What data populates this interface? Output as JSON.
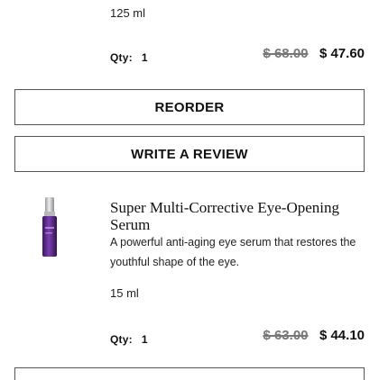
{
  "order_item_1": {
    "size": "125 ml",
    "qty_label": "Qty:",
    "qty_value": "1",
    "original_price": "$ 68.00",
    "sale_price": "$ 47.60"
  },
  "actions": {
    "reorder_label": "REORDER",
    "review_label": "WRITE A REVIEW"
  },
  "order_item_2": {
    "title": "Super Multi-Corrective Eye-Opening Serum",
    "description": "A powerful anti-aging eye serum that restores the youthful shape of the eye.",
    "size": "15 ml",
    "qty_label": "Qty:",
    "qty_value": "1",
    "original_price": "$ 63.00",
    "sale_price": "$ 44.10"
  },
  "colors": {
    "bottle_purple": "#5b2a86",
    "bottle_cap": "#c9c9cc"
  }
}
